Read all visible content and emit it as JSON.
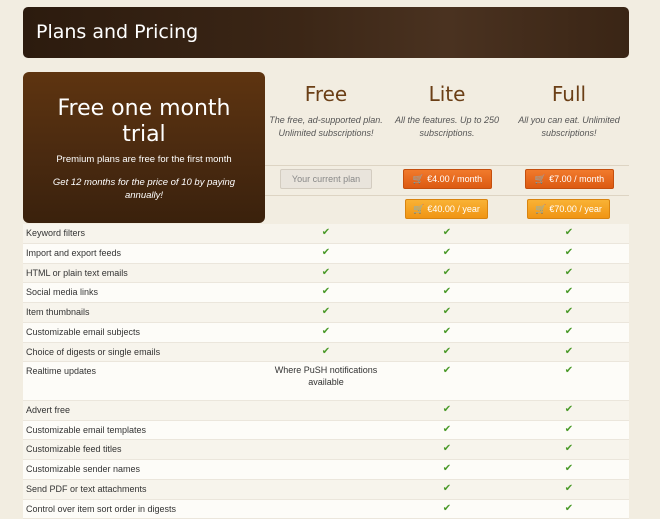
{
  "header": {
    "title": "Plans and Pricing"
  },
  "trial": {
    "title": "Free one month trial",
    "subtitle": "Premium plans are free for the first month",
    "note": "Get 12 months for the price of 10 by paying annually!"
  },
  "plans": [
    {
      "name": "Free",
      "desc": "The free, ad-supported plan. Unlimited subscriptions!",
      "current_label": "Your current plan"
    },
    {
      "name": "Lite",
      "desc": "All the features. Up to 250 subscriptions.",
      "month_label": "€4.00 / month",
      "year_label": "€40.00 / year"
    },
    {
      "name": "Full",
      "desc": "All you can eat. Unlimited subscriptions!",
      "month_label": "€7.00 / month",
      "year_label": "€70.00 / year"
    }
  ],
  "features": [
    {
      "label": "Keyword filters",
      "free": true,
      "lite": true,
      "full": true
    },
    {
      "label": "Import and export feeds",
      "free": true,
      "lite": true,
      "full": true
    },
    {
      "label": "HTML or plain text emails",
      "free": true,
      "lite": true,
      "full": true
    },
    {
      "label": "Social media links",
      "free": true,
      "lite": true,
      "full": true
    },
    {
      "label": "Item thumbnails",
      "free": true,
      "lite": true,
      "full": true
    },
    {
      "label": "Customizable email subjects",
      "free": true,
      "lite": true,
      "full": true
    },
    {
      "label": "Choice of digests or single emails",
      "free": true,
      "lite": true,
      "full": true
    },
    {
      "label": "Realtime updates",
      "free_note": "Where PuSH notifications available",
      "lite": true,
      "full": true
    },
    {
      "label": "Advert free",
      "free": false,
      "lite": true,
      "full": true
    },
    {
      "label": "Customizable email templates",
      "free": false,
      "lite": true,
      "full": true
    },
    {
      "label": "Customizable feed titles",
      "free": false,
      "lite": true,
      "full": true
    },
    {
      "label": "Customizable sender names",
      "free": false,
      "lite": true,
      "full": true
    },
    {
      "label": "Send PDF or text attachments",
      "free": false,
      "lite": true,
      "full": true
    },
    {
      "label": "Control over item sort order in digests",
      "free": false,
      "lite": true,
      "full": true
    }
  ],
  "icons": {
    "check": "checkmark-icon",
    "cart": "cart-icon"
  },
  "colors": {
    "accent_month": "#e3651b",
    "accent_year": "#f5a423",
    "check": "#4b9a2a",
    "plan_name": "#6b3f16"
  }
}
